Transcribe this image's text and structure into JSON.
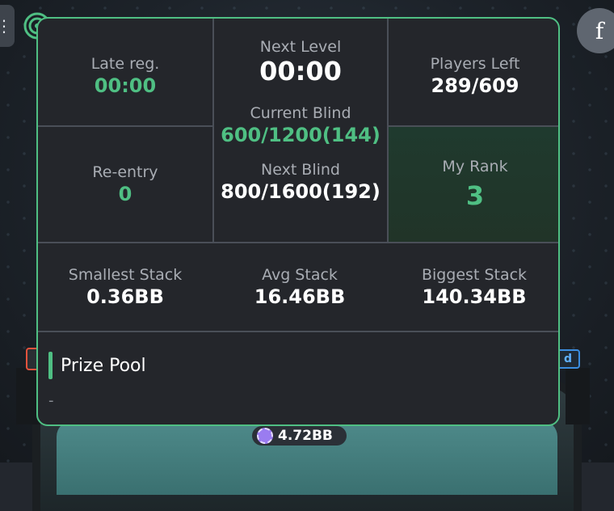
{
  "tournament_info": {
    "late_reg": {
      "label": "Late reg.",
      "value": "00:00"
    },
    "next_level": {
      "label": "Next Level",
      "value": "00:00"
    },
    "players_left": {
      "label": "Players Left",
      "value": "289/609"
    },
    "current_blind": {
      "label": "Current Blind",
      "value": "600/1200(144)"
    },
    "next_blind": {
      "label": "Next Blind",
      "value": "800/1600(192)"
    },
    "re_entry": {
      "label": "Re-entry",
      "value": "0"
    },
    "my_rank": {
      "label": "My Rank",
      "value": "3"
    },
    "smallest_stack": {
      "label": "Smallest Stack",
      "value": "0.36BB"
    },
    "avg_stack": {
      "label": "Avg Stack",
      "value": "16.46BB"
    },
    "biggest_stack": {
      "label": "Biggest Stack",
      "value": "140.34BB"
    },
    "prize_pool": {
      "label": "Prize Pool",
      "value": "-"
    }
  },
  "table": {
    "player_stack": "4.72BB",
    "avatar_letter": "f",
    "seat_tag_right": "d"
  },
  "colors": {
    "accent_green": "#4fbf83",
    "panel_bg": "#24262b",
    "divider": "#4a4f58"
  },
  "icons": [
    "menu-icon",
    "signal-icon",
    "chip-icon"
  ]
}
